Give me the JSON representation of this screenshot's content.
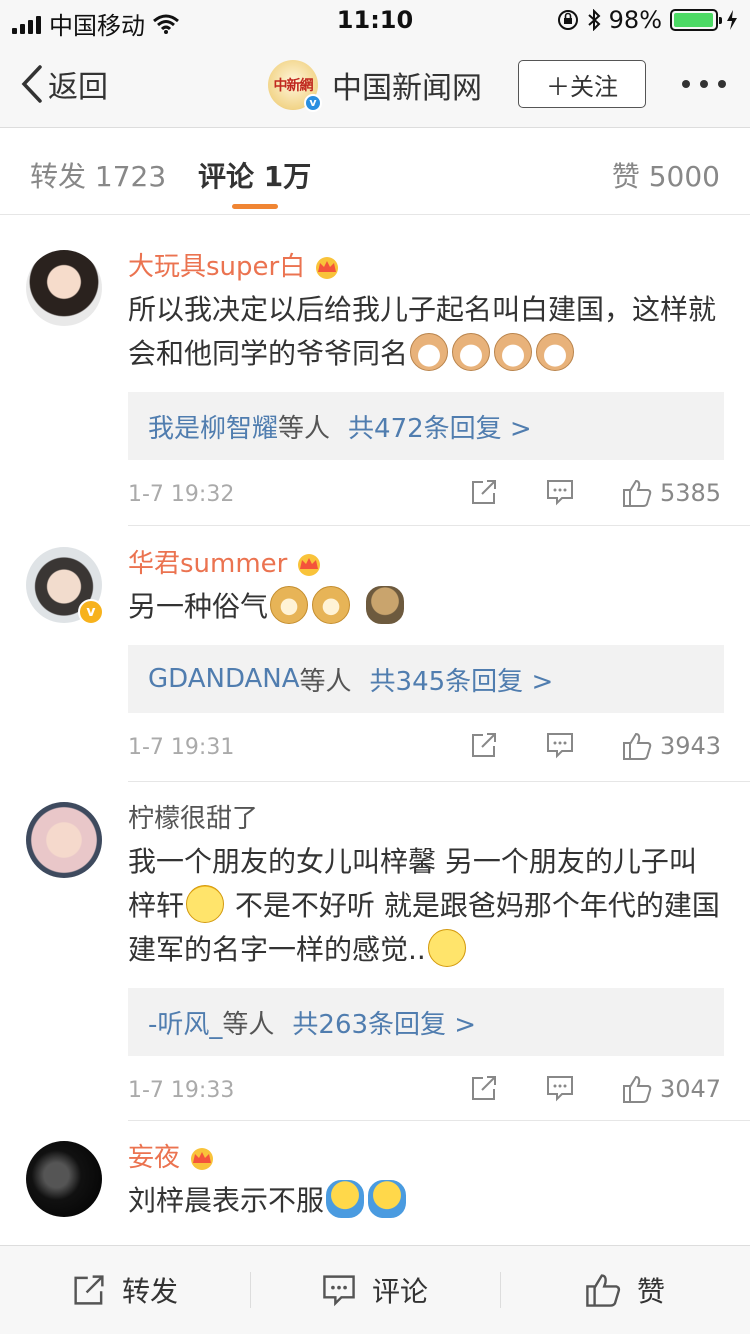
{
  "status_bar": {
    "carrier": "中国移动",
    "time": "11:10",
    "battery": "98%",
    "battery_level": 0.98
  },
  "nav": {
    "back_label": "返回",
    "logo_text": "中新網",
    "title": "中国新闻网",
    "follow_label": "＋关注"
  },
  "tabs": {
    "repost": "转发 1723",
    "comments": "评论 1万",
    "likes": "赞 5000"
  },
  "comments": [
    {
      "name": "大玩具super白",
      "text": "所以我决定以后给我儿子起名叫白建国，这样就会和他同学的爷爷同名",
      "reply_who": "我是柳智耀",
      "reply_etc": "等人",
      "reply_count": "共472条回复 >",
      "time": "1-7 19:32",
      "likes": "5385"
    },
    {
      "name": "华君summer",
      "text": "另一种俗气",
      "reply_who": "GDANDANA",
      "reply_etc": "等人",
      "reply_count": "共345条回复 >",
      "time": "1-7 19:31",
      "likes": "3943"
    },
    {
      "name": "柠檬很甜了",
      "text_a": "我一个朋友的女儿叫梓馨 另一个朋友的儿子叫梓轩",
      "text_b": " 不是不好听 就是跟爸妈那个年代的建国 建军的名字一样的感觉..",
      "reply_who": "-听风_",
      "reply_etc": "等人",
      "reply_count": "共263条回复 >",
      "time": "1-7 19:33",
      "likes": "3047"
    },
    {
      "name": "妄夜",
      "text": "刘梓晨表示不服"
    }
  ],
  "toolbar": {
    "repost": "转发",
    "comment": "评论",
    "like": "赞"
  },
  "icons": [
    "back-chevron-icon",
    "verified-icon",
    "more-icon",
    "vip-crown-icon",
    "share-icon",
    "comment-icon",
    "like-icon"
  ],
  "colors": {
    "accent": "#f08533",
    "vip_name": "#eb7350",
    "link": "#507daf"
  }
}
